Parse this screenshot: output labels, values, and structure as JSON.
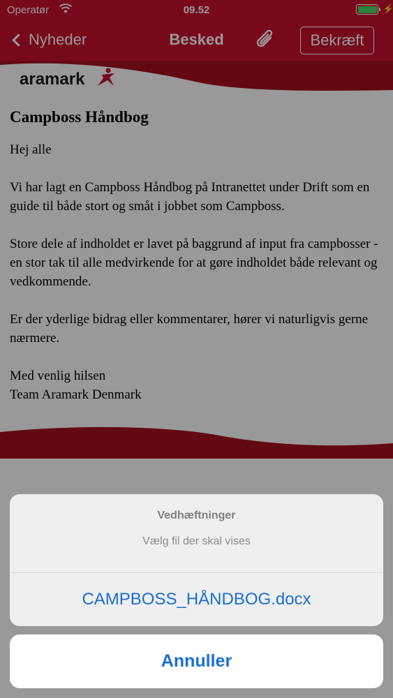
{
  "status_bar": {
    "carrier": "Operatør",
    "time": "09.52",
    "battery_level": 1.0
  },
  "nav": {
    "back_label": "Nyheder",
    "title": "Besked",
    "attachment_icon": "paperclip-icon",
    "confirm_label": "Bekræft"
  },
  "message": {
    "brand": "aramark",
    "heading": "Campboss Håndbog",
    "paragraphs": [
      "Hej alle",
      "Vi har lagt en Campboss Håndbog på Intranettet under Drift som en guide til både stort og småt i jobbet som Campboss.",
      "Store dele af indholdet er lavet på baggrund af input fra campbosser - en stor tak til alle medvirkende for at gøre indholdet både relevant og vedkommende.",
      "Er der yderlige bidrag eller kommentarer, hører vi naturligvis gerne nærmere."
    ],
    "signoff_line1": "Med venlig hilsen",
    "signoff_line2": "Team Aramark Denmark"
  },
  "action_sheet": {
    "title": "Vedhæftninger",
    "message": "Vælg fil der skal vises",
    "file_option": "CAMPBOSS_HÅNDBOG.docx",
    "cancel_label": "Annuller"
  },
  "colors": {
    "brand_red": "#c8102e",
    "action_blue": "#1a6fd1"
  }
}
